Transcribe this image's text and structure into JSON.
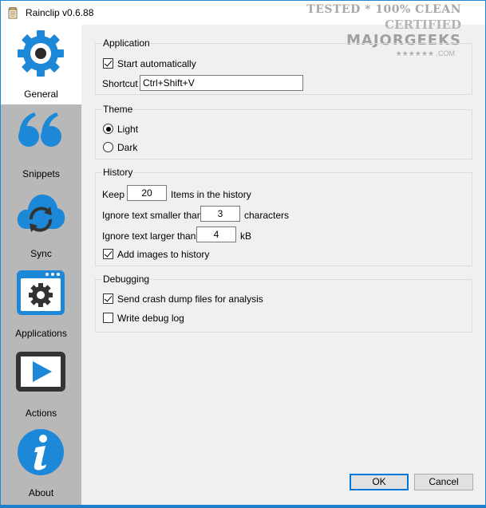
{
  "window": {
    "title": "Rainclip v0.6.88"
  },
  "watermark": {
    "line1": "TESTED * 100% CLEAN",
    "line2": "CERTIFIED",
    "line3": "MAJORGEEKS",
    "line4": "★★★★★★ .COM"
  },
  "sidebar": {
    "items": [
      {
        "label": "General",
        "icon": "gear-icon"
      },
      {
        "label": "Snippets",
        "icon": "quote-icon"
      },
      {
        "label": "Sync",
        "icon": "cloud-sync-icon"
      },
      {
        "label": "Applications",
        "icon": "app-gear-icon"
      },
      {
        "label": "Actions",
        "icon": "play-icon"
      },
      {
        "label": "About",
        "icon": "info-icon"
      }
    ],
    "active": "General"
  },
  "application": {
    "title": "Application",
    "start_auto_label": "Start automatically",
    "start_auto_checked": true,
    "shortcut_label": "Shortcut",
    "shortcut_value": "Ctrl+Shift+V"
  },
  "theme": {
    "title": "Theme",
    "options": [
      "Light",
      "Dark"
    ],
    "selected": "Light"
  },
  "history": {
    "title": "History",
    "keep_label": "Keep",
    "keep_value": "20",
    "keep_suffix": "Items in the history",
    "ignore_smaller_label": "Ignore text smaller than",
    "ignore_smaller_value": "3",
    "ignore_smaller_suffix": "characters",
    "ignore_larger_label": "Ignore text larger than",
    "ignore_larger_value": "4",
    "ignore_larger_suffix": "kB",
    "add_images_label": "Add images to history",
    "add_images_checked": true
  },
  "debugging": {
    "title": "Debugging",
    "crash_dump_label": "Send crash dump files for analysis",
    "crash_dump_checked": true,
    "debug_log_label": "Write debug log",
    "debug_log_checked": false
  },
  "buttons": {
    "ok": "OK",
    "cancel": "Cancel"
  },
  "colors": {
    "accent": "#1c8ad6",
    "icon_blue": "#1e88d8",
    "sidebar": "#b8b8b8"
  }
}
